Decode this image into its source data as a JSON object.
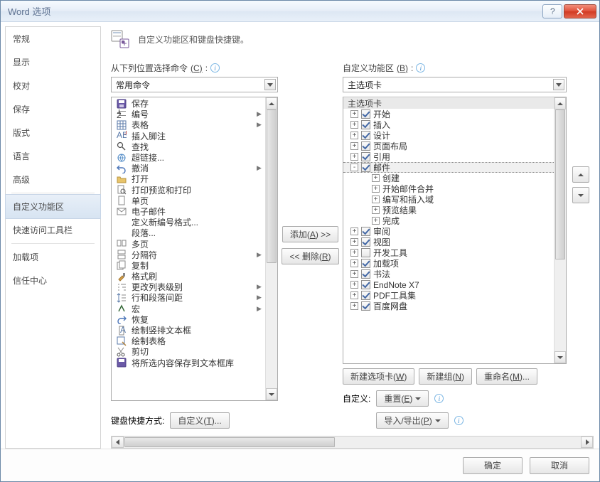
{
  "title": "Word 选项",
  "center_title_fuzz": "",
  "header_text": "自定义功能区和键盘快捷键。",
  "sidebar": {
    "items": [
      "常规",
      "显示",
      "校对",
      "保存",
      "版式",
      "语言",
      "高级",
      "自定义功能区",
      "快速访问工具栏",
      "加载项",
      "信任中心"
    ],
    "selected_index": 7,
    "separators_after": [
      6,
      8
    ]
  },
  "left_col": {
    "label": "从下列位置选择命令",
    "label_hotkey": "(C)",
    "combo_value": "常用命令",
    "items": [
      {
        "label": "保存",
        "icon": "save",
        "sub": false
      },
      {
        "label": "编号",
        "icon": "numlist",
        "sub": true
      },
      {
        "label": "表格",
        "icon": "table",
        "sub": true
      },
      {
        "label": "插入脚注",
        "icon": "footnote",
        "sub": false
      },
      {
        "label": "查找",
        "icon": "find",
        "sub": false
      },
      {
        "label": "超链接...",
        "icon": "hyperlink",
        "sub": false
      },
      {
        "label": "撤消",
        "icon": "undo",
        "sub": true
      },
      {
        "label": "打开",
        "icon": "open",
        "sub": false
      },
      {
        "label": "打印预览和打印",
        "icon": "preview",
        "sub": false
      },
      {
        "label": "单页",
        "icon": "onepage",
        "sub": false
      },
      {
        "label": "电子邮件",
        "icon": "email",
        "sub": false
      },
      {
        "label": "定义新编号格式...",
        "icon": "blank",
        "sub": false
      },
      {
        "label": "段落...",
        "icon": "blank",
        "sub": false
      },
      {
        "label": "多页",
        "icon": "multipage",
        "sub": false
      },
      {
        "label": "分隔符",
        "icon": "break",
        "sub": true
      },
      {
        "label": "复制",
        "icon": "copy",
        "sub": false
      },
      {
        "label": "格式刷",
        "icon": "brush",
        "sub": false
      },
      {
        "label": "更改列表级别",
        "icon": "listlevel",
        "sub": true
      },
      {
        "label": "行和段落间距",
        "icon": "spacing",
        "sub": true
      },
      {
        "label": "宏",
        "icon": "macro",
        "sub": true
      },
      {
        "label": "恢复",
        "icon": "redo",
        "sub": false
      },
      {
        "label": "绘制竖排文本框",
        "icon": "vtextbox",
        "sub": false
      },
      {
        "label": "绘制表格",
        "icon": "drawtable",
        "sub": false
      },
      {
        "label": "剪切",
        "icon": "cut",
        "sub": false
      },
      {
        "label": "将所选内容保存到文本框库",
        "icon": "savebox",
        "sub": false
      }
    ]
  },
  "mid": {
    "add": "添加(A) >>",
    "remove": "<< 删除(R)"
  },
  "right_col": {
    "label": "自定义功能区",
    "label_hotkey": "(B)",
    "combo_value": "主选项卡",
    "tree_header": "主选项卡",
    "nodes": [
      {
        "d": 0,
        "tw": "+",
        "cb": true,
        "label": "开始"
      },
      {
        "d": 0,
        "tw": "+",
        "cb": true,
        "label": "插入"
      },
      {
        "d": 0,
        "tw": "+",
        "cb": true,
        "label": "设计"
      },
      {
        "d": 0,
        "tw": "+",
        "cb": true,
        "label": "页面布局"
      },
      {
        "d": 0,
        "tw": "+",
        "cb": true,
        "label": "引用"
      },
      {
        "d": 0,
        "tw": "-",
        "cb": true,
        "label": "邮件",
        "sel": true
      },
      {
        "d": 1,
        "tw": "+",
        "cb": null,
        "label": "创建"
      },
      {
        "d": 1,
        "tw": "+",
        "cb": null,
        "label": "开始邮件合并"
      },
      {
        "d": 1,
        "tw": "+",
        "cb": null,
        "label": "编写和插入域"
      },
      {
        "d": 1,
        "tw": "+",
        "cb": null,
        "label": "预览结果"
      },
      {
        "d": 1,
        "tw": "+",
        "cb": null,
        "label": "完成"
      },
      {
        "d": 0,
        "tw": "+",
        "cb": true,
        "label": "审阅"
      },
      {
        "d": 0,
        "tw": "+",
        "cb": true,
        "label": "视图"
      },
      {
        "d": 0,
        "tw": "+",
        "cb": false,
        "label": "开发工具"
      },
      {
        "d": 0,
        "tw": "+",
        "cb": true,
        "label": "加载项"
      },
      {
        "d": 0,
        "tw": "+",
        "cb": true,
        "label": "书法"
      },
      {
        "d": 0,
        "tw": "+",
        "cb": true,
        "label": "EndNote X7"
      },
      {
        "d": 0,
        "tw": "+",
        "cb": true,
        "label": "PDF工具集"
      },
      {
        "d": 0,
        "tw": "+",
        "cb": true,
        "label": "百度网盘"
      }
    ],
    "buttons": {
      "new_tab": "新建选项卡(W)",
      "new_group": "新建组(N)",
      "rename": "重命名(M)..."
    },
    "customize_label": "自定义:",
    "reset_btn": "重置(E)",
    "import_export_btn": "导入/导出(P)"
  },
  "keyboard_row": {
    "label": "键盘快捷方式:",
    "btn": "自定义(T)..."
  },
  "dialog": {
    "ok": "确定",
    "cancel": "取消"
  }
}
